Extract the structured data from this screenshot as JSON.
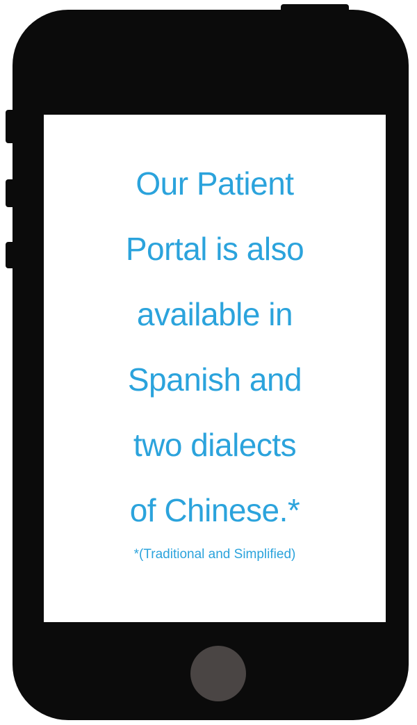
{
  "screen": {
    "headline_lines": [
      "Our Patient",
      "Portal is also",
      "available in",
      "Spanish and",
      "two dialects",
      "of Chinese.*"
    ],
    "footnote": "*(Traditional and Simplified)"
  },
  "colors": {
    "text_accent": "#2ba3dc",
    "phone_body": "#0b0b0b",
    "home_button": "#4a4544"
  }
}
